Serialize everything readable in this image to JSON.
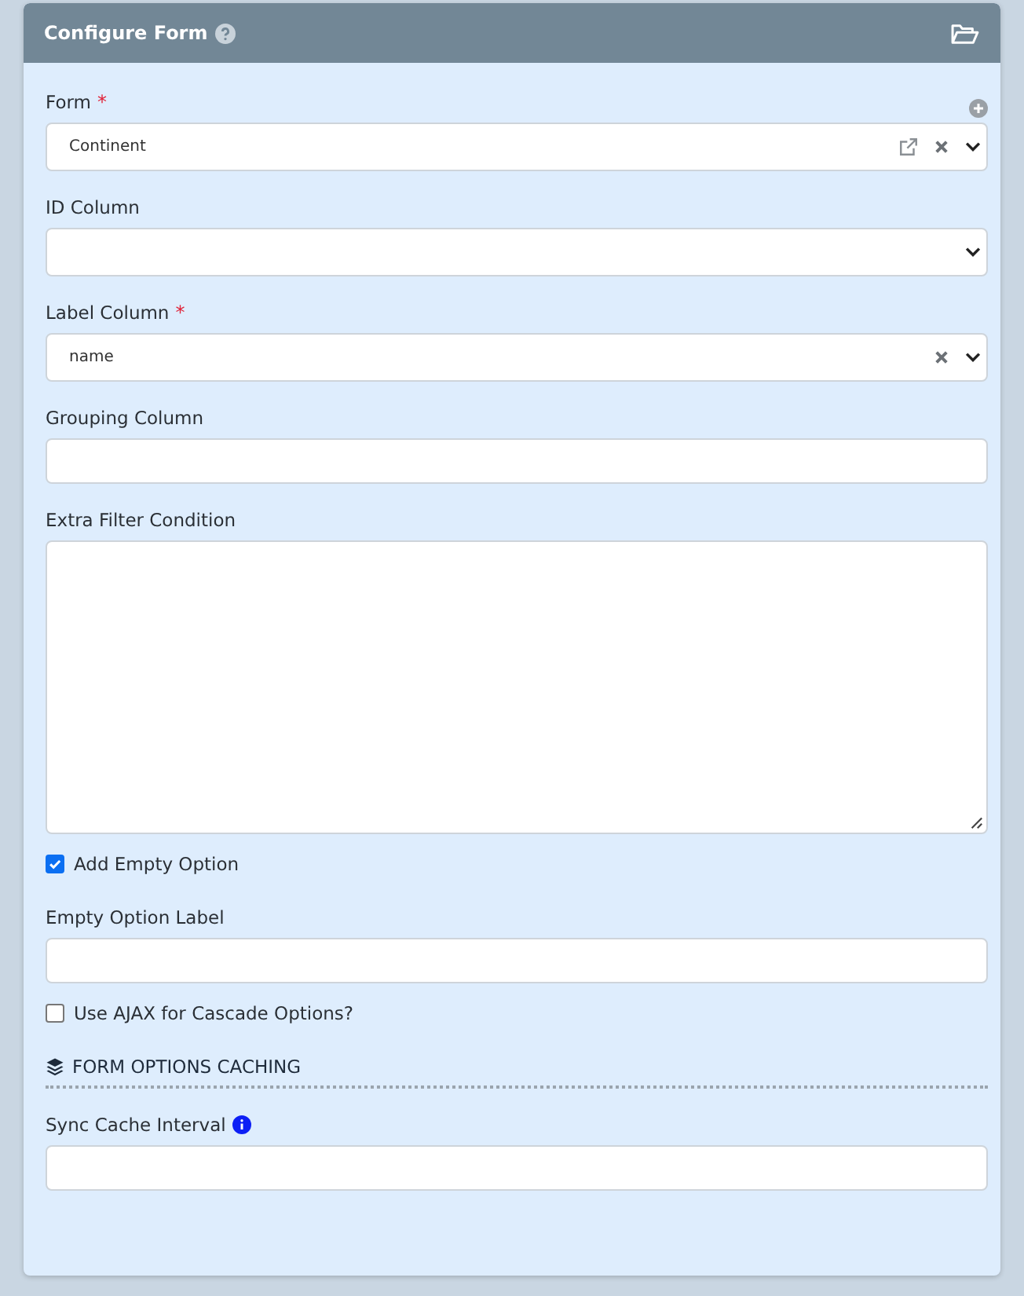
{
  "panel": {
    "title": "Configure Form"
  },
  "fields": [
    {
      "kind": "select",
      "label": "Form",
      "marker": "*",
      "value": "Continent",
      "clearable": true,
      "link": true,
      "addable": true
    },
    {
      "kind": "select",
      "label": "ID Column",
      "clearable": false,
      "link": false,
      "addable": false
    },
    {
      "kind": "select",
      "label": "Label Column",
      "marker": "*",
      "value": "name",
      "clearable": true,
      "link": false,
      "addable": false
    },
    {
      "kind": "input",
      "label": "Grouping Column"
    },
    {
      "kind": "textarea",
      "label": "Extra Filter Condition"
    },
    {
      "kind": "checkbox",
      "label": "Add Empty Option",
      "checked": true
    },
    {
      "kind": "input",
      "label": "Empty Option Label"
    },
    {
      "kind": "checkbox",
      "label": "Use AJAX for Cascade Options?",
      "checked": false
    },
    {
      "kind": "section",
      "label": "FORM OPTIONS CACHING"
    },
    {
      "kind": "input",
      "label": "Sync Cache Interval",
      "info": true
    }
  ]
}
